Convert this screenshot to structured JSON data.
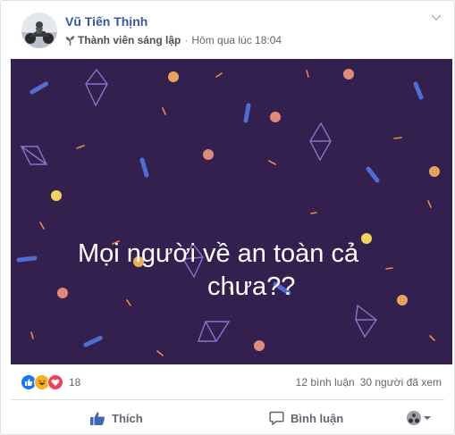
{
  "post": {
    "author": "Vũ Tiến Thịnh",
    "role": "Thành viên sáng lập",
    "separator": "·",
    "timestamp": "Hôm qua lúc 18:04",
    "headline_line1": "Mọi người về an toàn cả",
    "headline_line2": "chưa??",
    "banner_color": "#34204f"
  },
  "reactions": {
    "types": [
      "like-icon",
      "haha-icon",
      "love-icon"
    ],
    "count": "18",
    "comments": "12 bình luận",
    "views": "30 người đã xem"
  },
  "actions": {
    "like_label": "Thích",
    "comment_label": "Bình luận",
    "share_menu_icon": "avatar-dropdown-icon"
  },
  "colors": {
    "link": "#365899",
    "secondary_text": "#606770",
    "divider": "#dadde1",
    "like_blue": "#1877f2"
  }
}
